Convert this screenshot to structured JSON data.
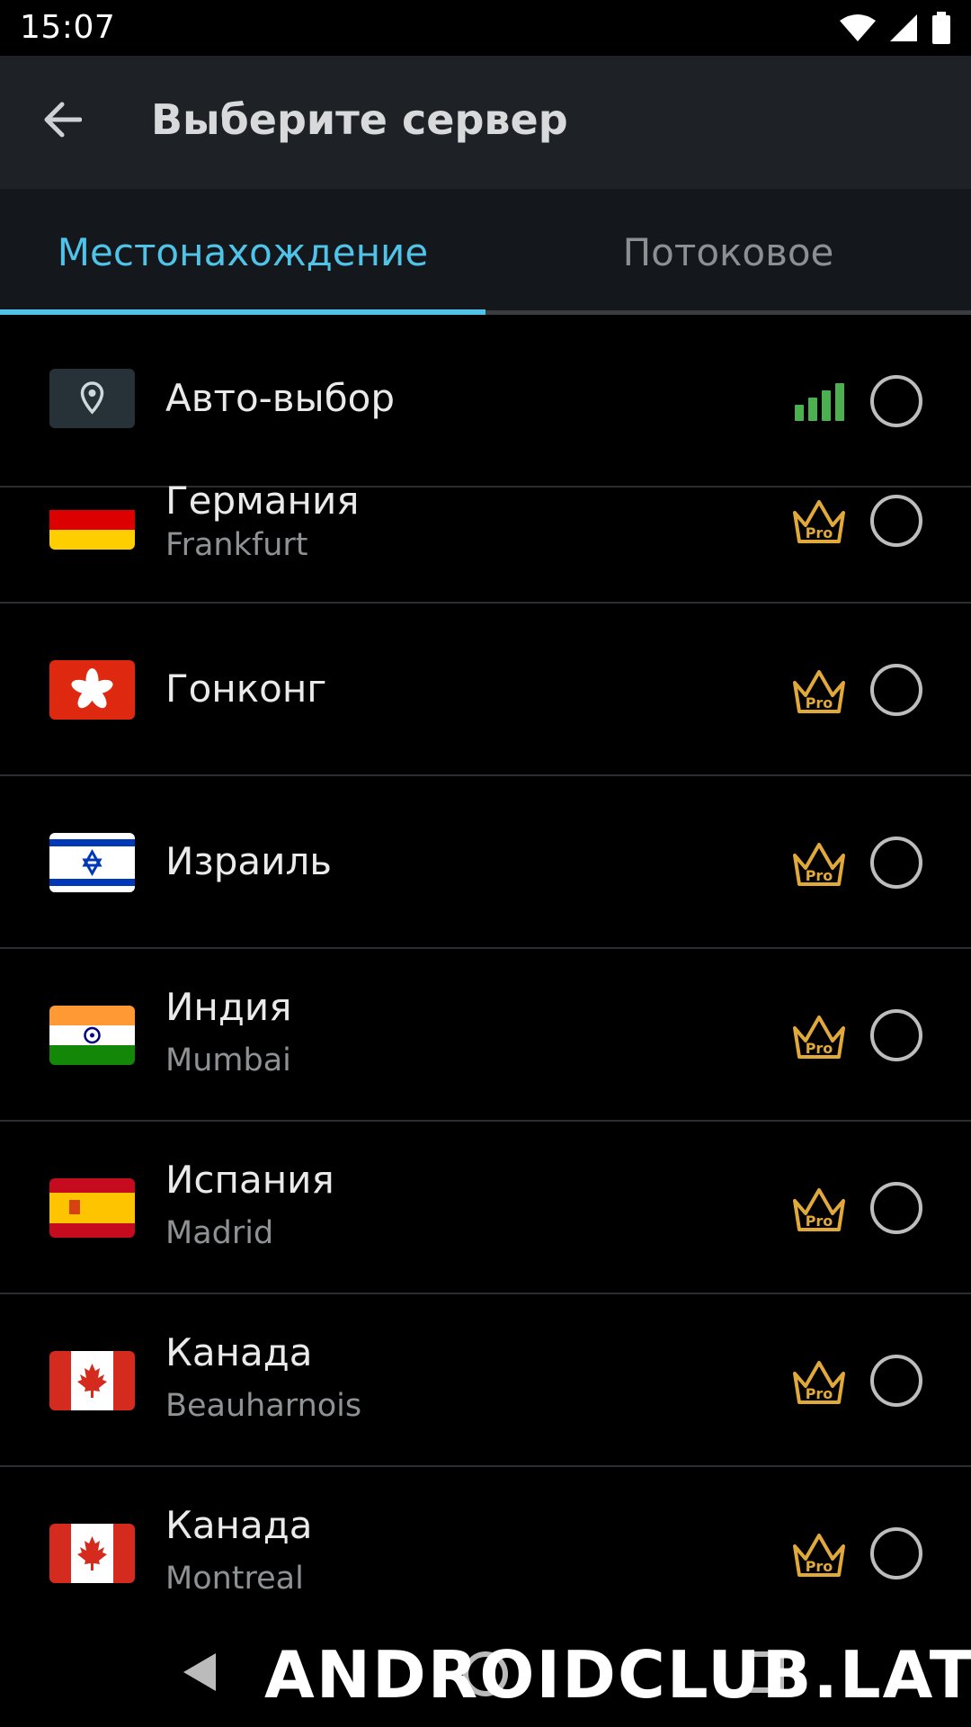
{
  "status_bar": {
    "time": "15:07"
  },
  "app_bar": {
    "title": "Выберите сервер"
  },
  "tabs": [
    {
      "label": "Местонахождение",
      "selected": true
    },
    {
      "label": "Потоковое",
      "selected": false
    }
  ],
  "colors": {
    "accent": "#4fc3e8",
    "pro_gold": "#e0a93a",
    "signal_green": "#4caf50"
  },
  "auto_select": {
    "label": "Авто-выбор",
    "icon": "location-pin-icon",
    "signal": "strong"
  },
  "servers": [
    {
      "country": "Германия",
      "city": "Frankfurt",
      "flag": "germany-flag",
      "badge": "Pro"
    },
    {
      "country": "Гонконг",
      "city": "",
      "flag": "hong-kong-flag",
      "badge": "Pro"
    },
    {
      "country": "Израиль",
      "city": "",
      "flag": "israel-flag",
      "badge": "Pro"
    },
    {
      "country": "Индия",
      "city": "Mumbai",
      "flag": "india-flag",
      "badge": "Pro"
    },
    {
      "country": "Испания",
      "city": "Madrid",
      "flag": "spain-flag",
      "badge": "Pro"
    },
    {
      "country": "Канада",
      "city": "Beauharnois",
      "flag": "canada-flag",
      "badge": "Pro"
    },
    {
      "country": "Канада",
      "city": "Montreal",
      "flag": "canada-flag",
      "badge": "Pro"
    }
  ],
  "watermark": "ANDROIDCLUB.LAT"
}
